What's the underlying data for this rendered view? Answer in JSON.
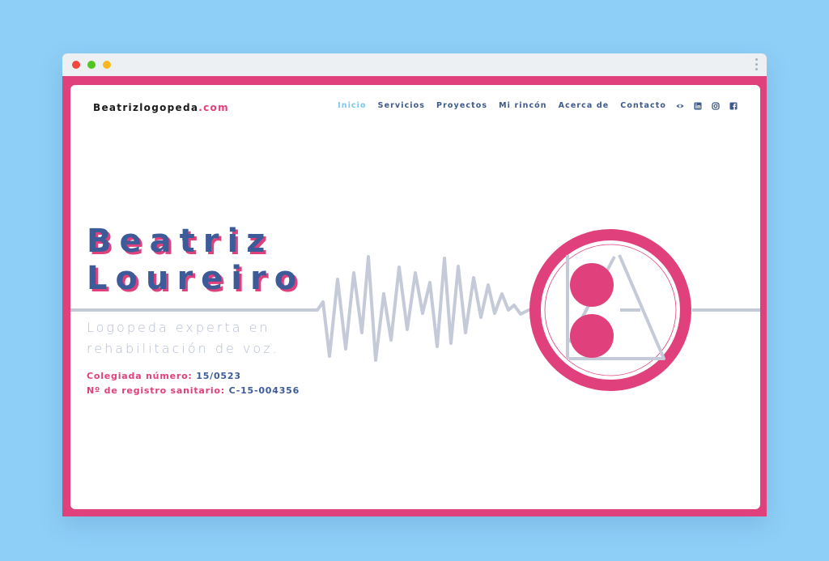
{
  "colors": {
    "background": "#8ecff7",
    "frame": "#e0407b",
    "accent_blue": "#3d5a99",
    "nav_active": "#7cc8ea",
    "wave": "#c5cad9"
  },
  "window": {
    "controls": [
      "close",
      "minimize",
      "maximize"
    ]
  },
  "header": {
    "brand_main": "Beatrizlogopeda",
    "brand_tld": ".com",
    "nav": [
      {
        "label": "Inicio",
        "active": true
      },
      {
        "label": "Servicios"
      },
      {
        "label": "Proyectos"
      },
      {
        "label": "Mi rincón"
      },
      {
        "label": "Acerca de"
      },
      {
        "label": "Contacto"
      }
    ],
    "icons": [
      "eye-icon",
      "linkedin-icon",
      "instagram-icon",
      "facebook-icon"
    ]
  },
  "hero": {
    "first_name": "Beatriz",
    "last_name": "Loureiro",
    "tagline": "Logopeda experta en rehabilitación de voz.",
    "colegiada_label": "Colegiada número: ",
    "colegiada_value": "15/0523",
    "registro_label": "Nº de registro sanitario: ",
    "registro_value": "C-15-004356",
    "logo": "BA-monogram-logo"
  }
}
